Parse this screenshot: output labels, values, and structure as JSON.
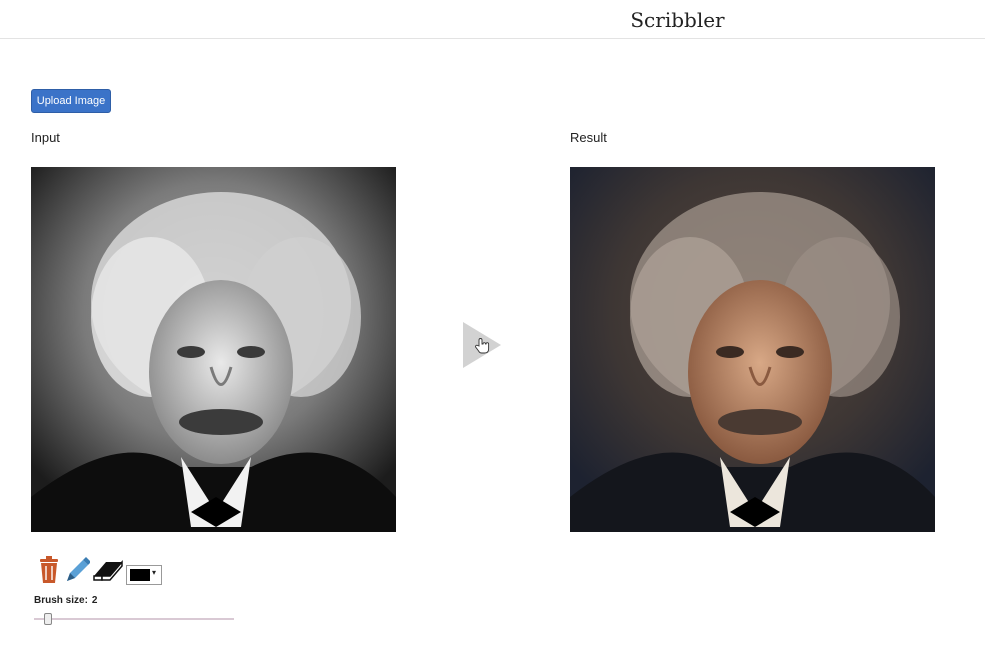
{
  "app": {
    "title": "Scribbler"
  },
  "toolbar": {
    "upload_label": "Upload Image"
  },
  "panels": {
    "input_label": "Input",
    "result_label": "Result"
  },
  "tools": {
    "icons": [
      "trash-icon",
      "pencil-icon",
      "eraser-icon"
    ],
    "color_value": "#000000",
    "color_arrow": "▾"
  },
  "brush": {
    "label": "Brush size:",
    "value": "2"
  },
  "colors": {
    "accent": "#3b73c8",
    "trash": "#c8582a",
    "pencil": "#5aa0d6",
    "play": "#d2d2d2"
  }
}
